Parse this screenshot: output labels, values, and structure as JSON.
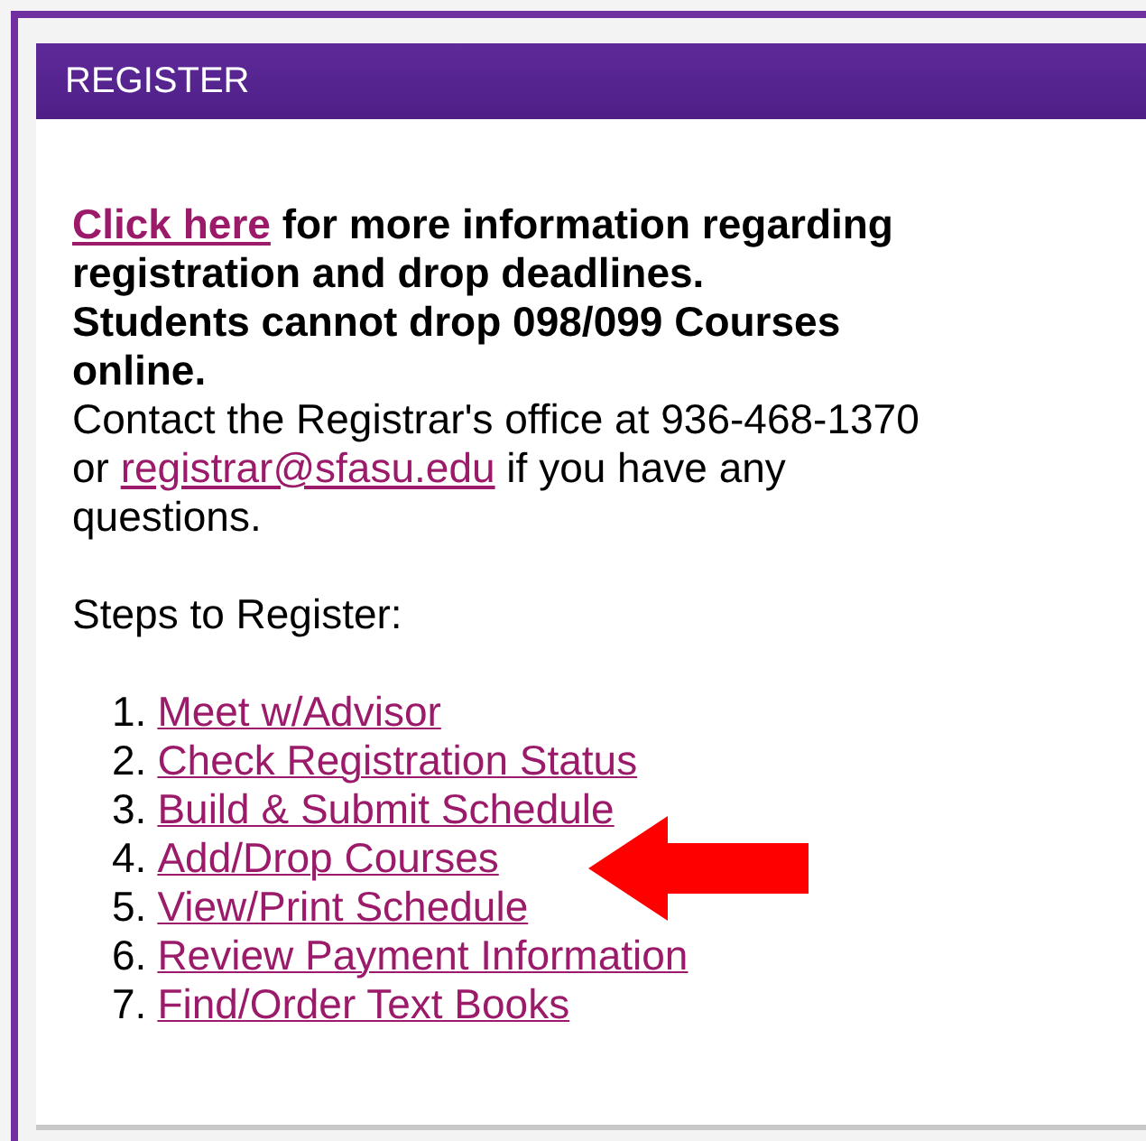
{
  "panel": {
    "title": "REGISTER"
  },
  "notice": {
    "link": "Click here",
    "text": "for more information regarding registration and drop deadlines.",
    "warning": "Students cannot drop 098/099 Courses online."
  },
  "contact": {
    "before": "Contact the Registrar's office at 936-468-1370 or",
    "email": "registrar@sfasu.edu",
    "after": "if you have any questions."
  },
  "steps_heading": "Steps to Register:",
  "steps": [
    {
      "number": "1.",
      "label": "Meet w/Advisor"
    },
    {
      "number": "2.",
      "label": "Check Registration Status"
    },
    {
      "number": "3.",
      "label": "Build & Submit Schedule"
    },
    {
      "number": "4.",
      "label": "Add/Drop Courses"
    },
    {
      "number": "5.",
      "label": "View/Print Schedule"
    },
    {
      "number": "6.",
      "label": "Review Payment Information"
    },
    {
      "number": "7.",
      "label": "Find/Order Text Books"
    }
  ]
}
